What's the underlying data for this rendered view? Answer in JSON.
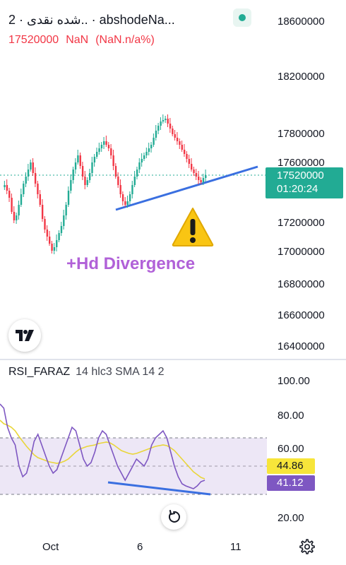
{
  "header": {
    "title": "شده نقدی · 2.. · abshodeNa...",
    "price": "17520000",
    "change": "NaN",
    "change_pct": "(NaN.n/a%)"
  },
  "price_axis": {
    "labels": [
      "18600000",
      "18200000",
      "17800000",
      "17600000",
      "17200000",
      "17000000",
      "16800000",
      "16600000",
      "16400000"
    ]
  },
  "last_price_tag": {
    "price": "17520000",
    "countdown": "01:20:24"
  },
  "annotation": {
    "divergence_text": "+Hd Divergence",
    "warning_icon": "warning-icon"
  },
  "indicator": {
    "name": "RSI_FARAZ",
    "params": "14 hlc3 SMA 14 2",
    "axis_labels": [
      "100.00",
      "80.00",
      "60.00",
      "20.00"
    ],
    "sma_value": "44.86",
    "rsi_value": "41.12"
  },
  "time_axis": {
    "labels": [
      "Oct",
      "6",
      "11"
    ]
  },
  "colors": {
    "up": "#22ab94",
    "down": "#f23645",
    "trendline": "#3a6fe0",
    "rsi": "#7e57c2",
    "sma": "#f7e53a",
    "band": "#ede7f6",
    "annotation": "#b161d8"
  },
  "icons": {
    "logo": "tradingview-logo-icon",
    "reset": "reset-icon",
    "settings": "gear-icon",
    "status": "market-open-dot-icon"
  }
}
